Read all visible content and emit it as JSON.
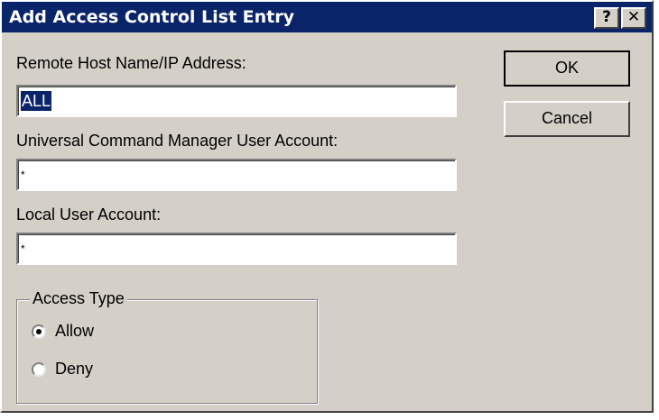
{
  "window": {
    "title": "Add Access Control List Entry",
    "help_label": "?",
    "close_label": "✕"
  },
  "form": {
    "remote_host_label": "Remote Host Name/IP Address:",
    "remote_host_value": "ALL",
    "ucm_account_label": "Universal Command Manager User Account:",
    "ucm_account_value": "*",
    "local_account_label": "Local User Account:",
    "local_account_value": "*"
  },
  "buttons": {
    "ok_label": "OK",
    "cancel_label": "Cancel"
  },
  "access_type": {
    "group_label": "Access Type",
    "options": [
      {
        "label": "Allow",
        "selected": true
      },
      {
        "label": "Deny",
        "selected": false
      }
    ]
  }
}
